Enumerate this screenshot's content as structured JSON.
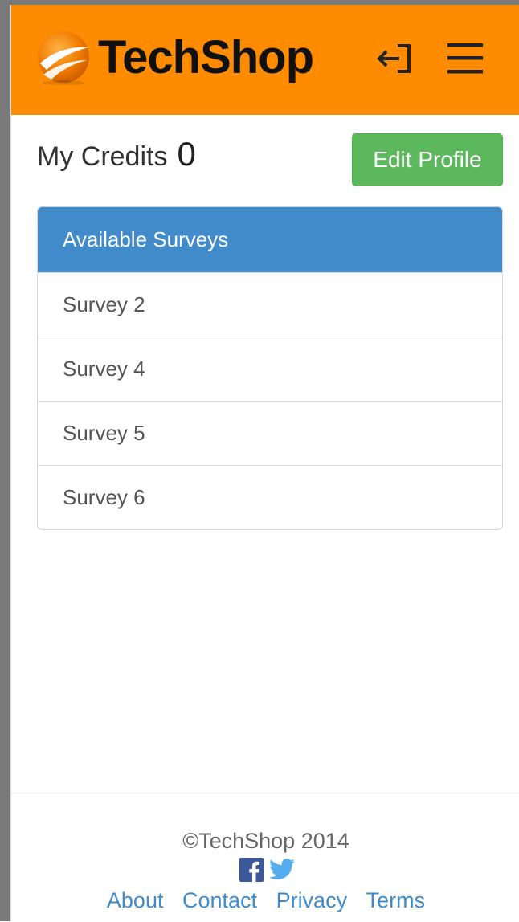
{
  "header": {
    "brand": "TechShop",
    "login_icon": "sign-in-icon",
    "menu_icon": "hamburger-menu-icon",
    "background_color": "#ff8c00"
  },
  "credits": {
    "label": "My Credits",
    "value": "0"
  },
  "edit_profile": {
    "label": "Edit Profile",
    "color": "#5cb85c"
  },
  "surveys": {
    "heading": "Available Surveys",
    "heading_color": "#428bca",
    "items": [
      {
        "label": "Survey 2"
      },
      {
        "label": "Survey 4"
      },
      {
        "label": "Survey 5"
      },
      {
        "label": "Survey 6"
      }
    ]
  },
  "footer": {
    "copyright": "©TechShop 2014",
    "social": [
      "facebook-icon",
      "twitter-icon"
    ],
    "links": [
      {
        "label": "About"
      },
      {
        "label": "Contact"
      },
      {
        "label": "Privacy"
      },
      {
        "label": "Terms"
      }
    ]
  }
}
